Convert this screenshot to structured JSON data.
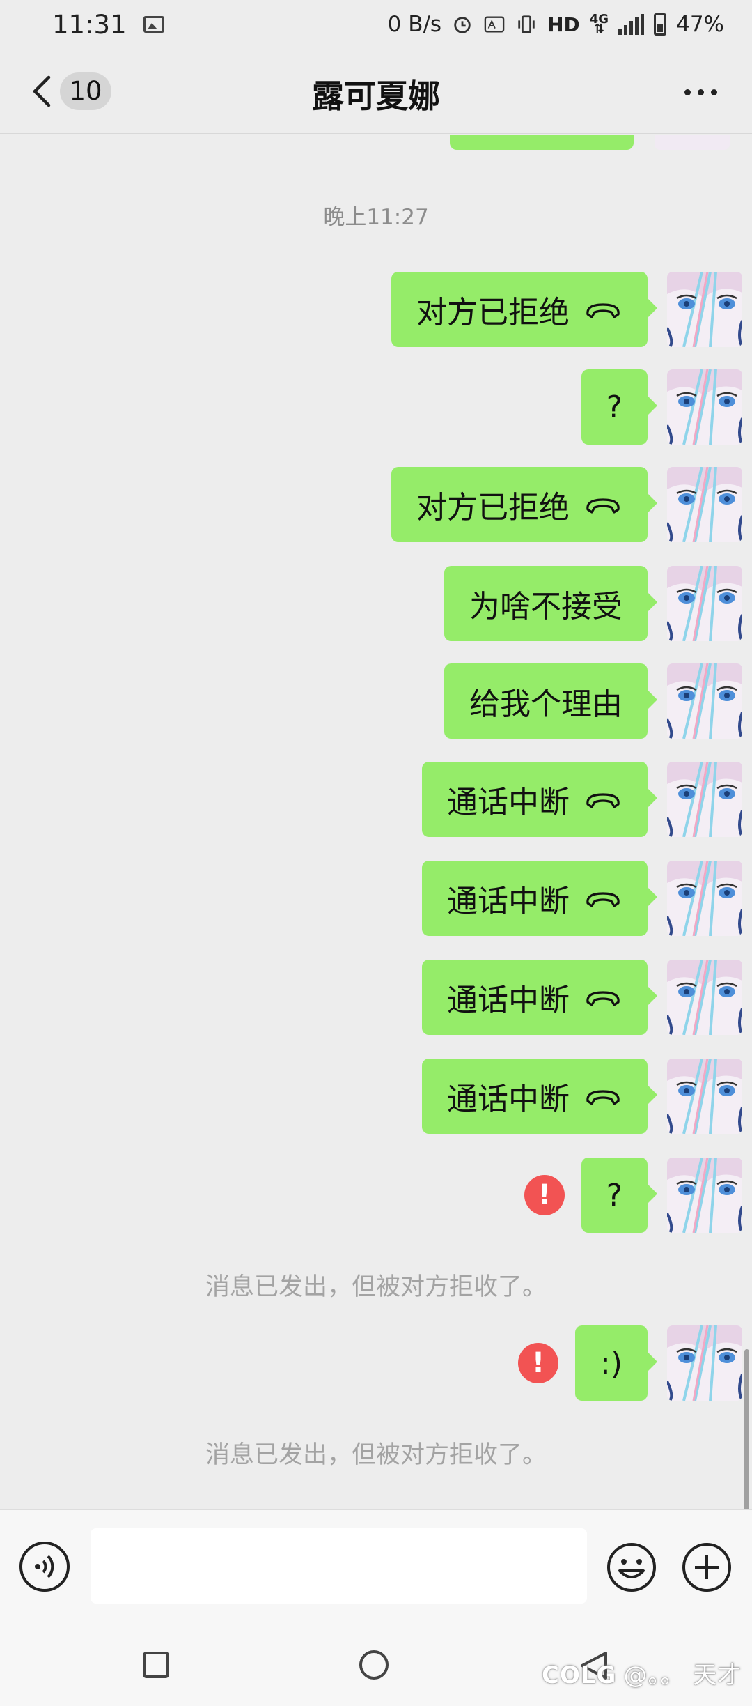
{
  "status": {
    "time": "11:31",
    "speed": "0 B/s",
    "hd": "HD",
    "network": "4G",
    "battery": "47%"
  },
  "header": {
    "unread": "10",
    "title": "露可夏娜"
  },
  "chat": {
    "timestamp": "晚上11:27",
    "messages": [
      {
        "text": "对方已拒绝",
        "call_icon": true
      },
      {
        "text": "?"
      },
      {
        "text": "对方已拒绝",
        "call_icon": true
      },
      {
        "text": "为啥不接受"
      },
      {
        "text": "给我个理由"
      },
      {
        "text": "通话中断",
        "call_icon": true
      },
      {
        "text": "通话中断",
        "call_icon": true
      },
      {
        "text": "通话中断",
        "call_icon": true
      },
      {
        "text": "通话中断",
        "call_icon": true
      },
      {
        "text": "?",
        "failed": true,
        "note": "消息已发出，但被对方拒收了。"
      },
      {
        "text": ":)",
        "failed": true,
        "note": "消息已发出，但被对方拒收了。"
      }
    ],
    "error_mark": "!"
  },
  "watermark": {
    "brand": "COLG",
    "handle": "@。。 天才"
  },
  "colors": {
    "bubble": "#95ec69",
    "background": "#ededed",
    "error": "#f25353"
  },
  "icons": [
    "back-arrow-icon",
    "more-icon",
    "voice-icon",
    "emoji-icon",
    "plus-icon",
    "phone-hangup-icon"
  ]
}
